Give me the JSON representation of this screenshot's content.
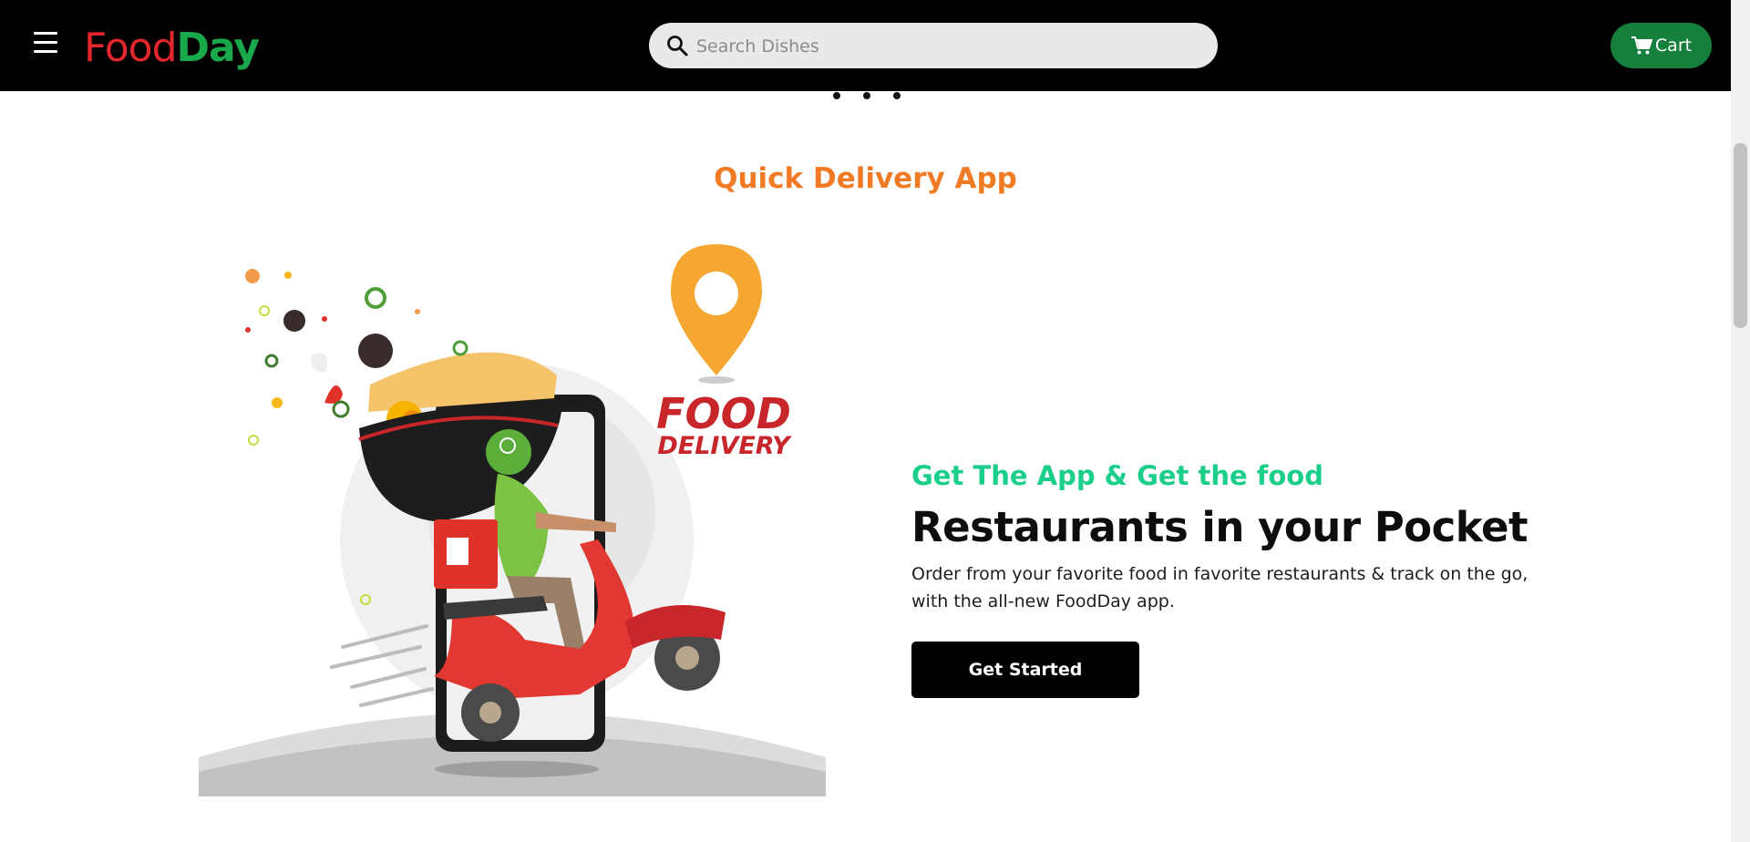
{
  "header": {
    "logo_part1": "Food",
    "logo_part2": "Day",
    "search_placeholder": "Search Dishes",
    "cart_label": "Cart"
  },
  "hero": {
    "section_title": "Quick Delivery App",
    "tagline": "Get The App & Get the food",
    "headline": "Restaurants in your Pocket",
    "description": "Order from your favorite food in favorite restaurants & track on the go, with the all-new FoodDay app.",
    "cta_label": "Get Started"
  },
  "illustration": {
    "logo_line1": "FOOD",
    "logo_line2": "DELIVERY"
  },
  "colors": {
    "navbar": "#000000",
    "logo_red": "#e1262d",
    "logo_green": "#19a84a",
    "cart_green": "#157f3c",
    "title_orange": "#f17b25",
    "tagline_green": "#1bcf8a"
  },
  "icons": {
    "menu": "hamburger-menu-icon",
    "search": "search-icon",
    "cart": "cart-icon"
  }
}
